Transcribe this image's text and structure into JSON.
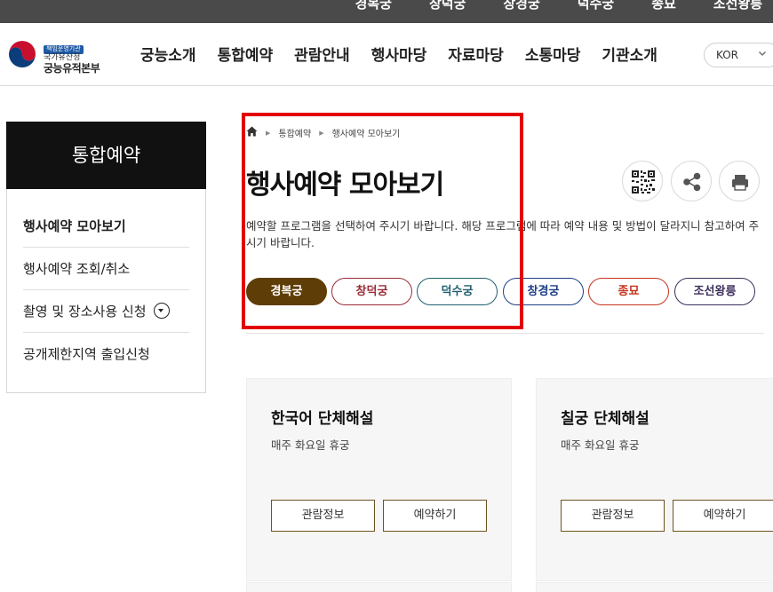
{
  "topbar": {
    "links": [
      "경복궁",
      "창덕궁",
      "창경궁",
      "덕수궁",
      "종묘",
      "조선왕릉"
    ]
  },
  "logo": {
    "badge": "책임운영기관",
    "sub": "국가유산청",
    "main": "궁능유적본부"
  },
  "nav": {
    "items": [
      "궁능소개",
      "통합예약",
      "관람안내",
      "행사마당",
      "자료마당",
      "소통마당",
      "기관소개"
    ]
  },
  "language": {
    "selected": "KOR",
    "icon": "chevron-down-icon"
  },
  "sidebar": {
    "title": "통합예약",
    "items": [
      {
        "label": "행사예약 모아보기",
        "active": true
      },
      {
        "label": "행사예약 조회/취소",
        "active": false
      },
      {
        "label": "촬영 및 장소사용 신청",
        "active": false,
        "has_toggle": true
      },
      {
        "label": "공개제한지역 출입신청",
        "active": false
      }
    ]
  },
  "breadcrumb": {
    "home_icon": "home-icon",
    "items": [
      "통합예약",
      "행사예약 모아보기"
    ]
  },
  "page": {
    "title": "행사예약 모아보기",
    "description": "예약할 프로그램을 선택하여 주시기 바랍니다. 해당 프로그램에 따라 예약 내용 및 방법이 달라지니 참고하여 주시기 바랍니다."
  },
  "tools": {
    "icons": [
      "qr-code-icon",
      "share-icon",
      "print-icon"
    ]
  },
  "palace_tabs": [
    {
      "label": "경복궁",
      "selected": true,
      "color": "#5e3d07"
    },
    {
      "label": "창덕궁",
      "selected": false,
      "color": "#9a2a36"
    },
    {
      "label": "덕수궁",
      "selected": false,
      "color": "#1f5f6e"
    },
    {
      "label": "창경궁",
      "selected": false,
      "color": "#1c3f86"
    },
    {
      "label": "종묘",
      "selected": false,
      "color": "#c5321d"
    },
    {
      "label": "조선왕릉",
      "selected": false,
      "color": "#3b2d5c"
    }
  ],
  "cards": [
    {
      "title": "한국어 단체해설",
      "note": "매주 화요일 휴궁",
      "info_label": "관람정보",
      "reserve_label": "예약하기"
    },
    {
      "title": "칠궁 단체해설",
      "note": "매주 화요일 휴궁",
      "info_label": "관람정보",
      "reserve_label": "예약하기"
    }
  ],
  "colors": {
    "topbar": "#4a4a4a",
    "sidebar_title_bg": "#111111",
    "card_bg": "#f6f6f6",
    "card_button_border": "#6b5320",
    "highlight": "#e20000"
  }
}
